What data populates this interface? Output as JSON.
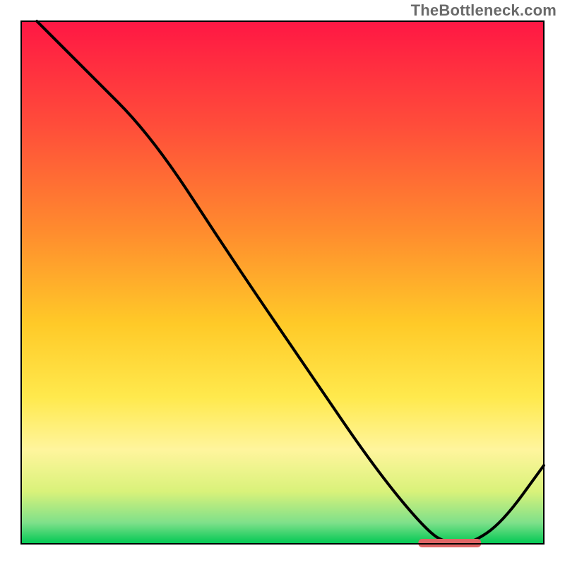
{
  "watermark": "TheBottleneck.com",
  "chart_data": {
    "type": "line",
    "title": "",
    "xlabel": "",
    "ylabel": "",
    "xlim": [
      0,
      100
    ],
    "ylim": [
      0,
      100
    ],
    "grid": false,
    "series": [
      {
        "name": "bottleneck-curve",
        "x": [
          3,
          12,
          25,
          40,
          55,
          68,
          78,
          82,
          86,
          92,
          100
        ],
        "y": [
          100,
          91,
          78,
          55,
          33,
          14,
          2,
          0,
          0,
          4,
          15
        ]
      }
    ],
    "optimal_zone": {
      "x_start": 76,
      "x_end": 88,
      "y": 0
    },
    "gradient_stops": [
      {
        "offset": 0,
        "color": "#ff1744"
      },
      {
        "offset": 20,
        "color": "#ff4d3a"
      },
      {
        "offset": 40,
        "color": "#ff8b2e"
      },
      {
        "offset": 58,
        "color": "#ffca28"
      },
      {
        "offset": 72,
        "color": "#ffe94d"
      },
      {
        "offset": 82,
        "color": "#fff59d"
      },
      {
        "offset": 90,
        "color": "#d9f27a"
      },
      {
        "offset": 96,
        "color": "#7ee08a"
      },
      {
        "offset": 100,
        "color": "#00c853"
      }
    ],
    "colors": {
      "curve": "#000000",
      "marker": "#e06666",
      "border": "#000000"
    }
  }
}
